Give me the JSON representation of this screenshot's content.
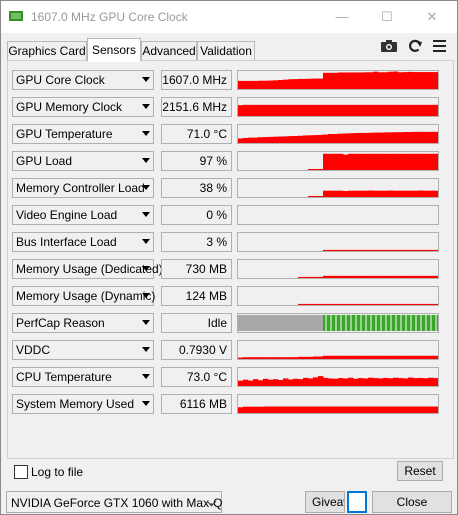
{
  "window": {
    "title": "1607.0 MHz GPU Core Clock",
    "minimize": "—",
    "maximize": "☐",
    "close": "✕"
  },
  "tabs": [
    {
      "label": "Graphics Card"
    },
    {
      "label": "Sensors",
      "active": true
    },
    {
      "label": "Advanced"
    },
    {
      "label": "Validation"
    }
  ],
  "toolbar": {
    "icons": [
      "camera-icon",
      "refresh-icon",
      "menu-icon"
    ]
  },
  "sensors": [
    {
      "name": "GPU Core Clock",
      "value": "1607.0 MHz",
      "history": [
        0.45,
        0.45,
        0.45,
        0.45,
        0.46,
        0.46,
        0.47,
        0.48,
        0.5,
        0.52,
        0.54,
        0.55,
        0.56,
        0.56,
        0.57,
        0.58,
        0.58,
        0.9,
        0.9,
        0.9,
        0.92,
        0.92,
        0.92,
        0.92,
        0.92,
        0.93,
        0.93,
        0.96,
        0.93,
        0.93,
        0.96,
        0.97,
        0.93,
        0.94,
        0.95,
        0.94,
        0.94,
        0.94,
        0.94,
        0.94
      ]
    },
    {
      "name": "GPU Memory Clock",
      "value": "2151.6 MHz",
      "history": [
        0.6,
        0.62,
        0.62,
        0.62,
        0.62,
        0.62,
        0.62,
        0.62,
        0.62,
        0.62,
        0.62,
        0.62,
        0.62,
        0.62,
        0.62,
        0.62,
        0.62,
        0.62,
        0.62,
        0.62,
        0.62,
        0.62,
        0.62,
        0.62,
        0.62,
        0.62,
        0.62,
        0.62,
        0.62,
        0.62,
        0.62,
        0.62,
        0.62,
        0.62,
        0.62,
        0.62,
        0.62,
        0.62,
        0.62,
        0.62
      ]
    },
    {
      "name": "GPU Temperature",
      "value": "71.0 °C",
      "history": [
        0.25,
        0.28,
        0.3,
        0.3,
        0.32,
        0.33,
        0.34,
        0.35,
        0.36,
        0.37,
        0.38,
        0.39,
        0.4,
        0.42,
        0.43,
        0.44,
        0.45,
        0.47,
        0.5,
        0.5,
        0.52,
        0.53,
        0.54,
        0.55,
        0.56,
        0.56,
        0.57,
        0.58,
        0.58,
        0.59,
        0.59,
        0.6,
        0.6,
        0.61,
        0.61,
        0.62,
        0.62,
        0.62,
        0.62,
        0.62
      ]
    },
    {
      "name": "GPU Load",
      "value": "97 %",
      "history": [
        0,
        0,
        0,
        0,
        0,
        0,
        0,
        0,
        0,
        0,
        0,
        0,
        0,
        0,
        0.05,
        0.05,
        0.05,
        0.9,
        0.9,
        0.9,
        0.9,
        0.85,
        0.9,
        0.9,
        0.9,
        0.9,
        0.9,
        0.9,
        0.9,
        0.9,
        0.9,
        0.9,
        0.9,
        0.9,
        0.9,
        0.9,
        0.9,
        0.9,
        0.9,
        0.9
      ]
    },
    {
      "name": "Memory Controller Load",
      "value": "38 %",
      "history": [
        0,
        0,
        0,
        0,
        0,
        0,
        0,
        0,
        0,
        0,
        0,
        0,
        0,
        0,
        0.04,
        0.04,
        0.04,
        0.35,
        0.35,
        0.35,
        0.35,
        0.33,
        0.35,
        0.35,
        0.35,
        0.35,
        0.36,
        0.35,
        0.35,
        0.35,
        0.36,
        0.35,
        0.35,
        0.35,
        0.35,
        0.35,
        0.36,
        0.35,
        0.35,
        0.35
      ]
    },
    {
      "name": "Video Engine Load",
      "value": "0 %",
      "history": [
        0,
        0,
        0,
        0,
        0,
        0,
        0,
        0,
        0,
        0,
        0,
        0,
        0,
        0,
        0,
        0,
        0,
        0,
        0,
        0,
        0,
        0,
        0,
        0,
        0,
        0,
        0,
        0,
        0,
        0,
        0,
        0,
        0,
        0,
        0,
        0,
        0,
        0,
        0,
        0
      ]
    },
    {
      "name": "Bus Interface Load",
      "value": "3 %",
      "history": [
        0,
        0,
        0,
        0,
        0,
        0,
        0,
        0,
        0,
        0,
        0,
        0,
        0,
        0,
        0,
        0,
        0,
        0.06,
        0.06,
        0.06,
        0.06,
        0.06,
        0.06,
        0.06,
        0.06,
        0.06,
        0.06,
        0.06,
        0.06,
        0.06,
        0.06,
        0.06,
        0.06,
        0.06,
        0.06,
        0.06,
        0.06,
        0.06,
        0.06,
        0.06
      ]
    },
    {
      "name": "Memory Usage (Dedicated)",
      "value": "730 MB",
      "history": [
        0,
        0,
        0,
        0,
        0,
        0,
        0,
        0,
        0,
        0,
        0,
        0,
        0.06,
        0.06,
        0.06,
        0.06,
        0.06,
        0.12,
        0.12,
        0.12,
        0.12,
        0.12,
        0.12,
        0.12,
        0.12,
        0.12,
        0.12,
        0.12,
        0.12,
        0.12,
        0.12,
        0.12,
        0.12,
        0.12,
        0.12,
        0.12,
        0.12,
        0.12,
        0.12,
        0.12
      ]
    },
    {
      "name": "Memory Usage (Dynamic)",
      "value": "124 MB",
      "history": [
        0,
        0,
        0,
        0,
        0,
        0,
        0,
        0,
        0,
        0,
        0,
        0,
        0.06,
        0.06,
        0.06,
        0.06,
        0.06,
        0.06,
        0.06,
        0.06,
        0.06,
        0.06,
        0.06,
        0.06,
        0.06,
        0.06,
        0.06,
        0.06,
        0.06,
        0.06,
        0.06,
        0.06,
        0.06,
        0.06,
        0.06,
        0.06,
        0.06,
        0.06,
        0.06,
        0.06
      ]
    },
    {
      "name": "PerfCap Reason",
      "value": "Idle",
      "perfcap": true
    },
    {
      "name": "VDDC",
      "value": "0.7930 V",
      "history": [
        0.08,
        0.1,
        0.1,
        0.1,
        0.1,
        0.1,
        0.1,
        0.1,
        0.1,
        0.1,
        0.1,
        0.1,
        0.12,
        0.12,
        0.12,
        0.14,
        0.14,
        0.18,
        0.18,
        0.18,
        0.18,
        0.18,
        0.18,
        0.18,
        0.18,
        0.18,
        0.18,
        0.18,
        0.18,
        0.18,
        0.18,
        0.18,
        0.18,
        0.18,
        0.18,
        0.18,
        0.18,
        0.18,
        0.18,
        0.18
      ]
    },
    {
      "name": "CPU Temperature",
      "value": "73.0 °C",
      "history": [
        0.3,
        0.35,
        0.3,
        0.38,
        0.32,
        0.4,
        0.35,
        0.38,
        0.33,
        0.42,
        0.36,
        0.4,
        0.38,
        0.45,
        0.42,
        0.48,
        0.55,
        0.45,
        0.42,
        0.4,
        0.44,
        0.42,
        0.46,
        0.4,
        0.44,
        0.42,
        0.46,
        0.44,
        0.42,
        0.45,
        0.43,
        0.46,
        0.44,
        0.42,
        0.47,
        0.44,
        0.45,
        0.43,
        0.46,
        0.44
      ]
    },
    {
      "name": "System Memory Used",
      "value": "6116 MB",
      "history": [
        0.32,
        0.35,
        0.35,
        0.35,
        0.35,
        0.36,
        0.36,
        0.36,
        0.36,
        0.36,
        0.36,
        0.36,
        0.36,
        0.36,
        0.36,
        0.36,
        0.36,
        0.36,
        0.36,
        0.36,
        0.36,
        0.36,
        0.36,
        0.36,
        0.36,
        0.36,
        0.36,
        0.36,
        0.36,
        0.36,
        0.36,
        0.36,
        0.36,
        0.36,
        0.36,
        0.36,
        0.36,
        0.36,
        0.36,
        0.36
      ]
    }
  ],
  "perfcap": {
    "idle_color": "#a8a8a8",
    "active_color": "#3aa52a",
    "segments": [
      0,
      0,
      0,
      0,
      0,
      0,
      0,
      0,
      0,
      0,
      0,
      0,
      0,
      0,
      0,
      0,
      0,
      1,
      1,
      1,
      1,
      1,
      1,
      1,
      1,
      1,
      1,
      1,
      1,
      1,
      1,
      1,
      1,
      1,
      1,
      1,
      1,
      1,
      1,
      1
    ]
  },
  "graph_color": "#ff0000",
  "footer": {
    "log_label": "Log to file",
    "reset_label": "Reset",
    "gpu_select": "NVIDIA GeForce GTX 1060 with Max-Q",
    "giveaway_label": "Giveaway",
    "close_label": "Close"
  }
}
